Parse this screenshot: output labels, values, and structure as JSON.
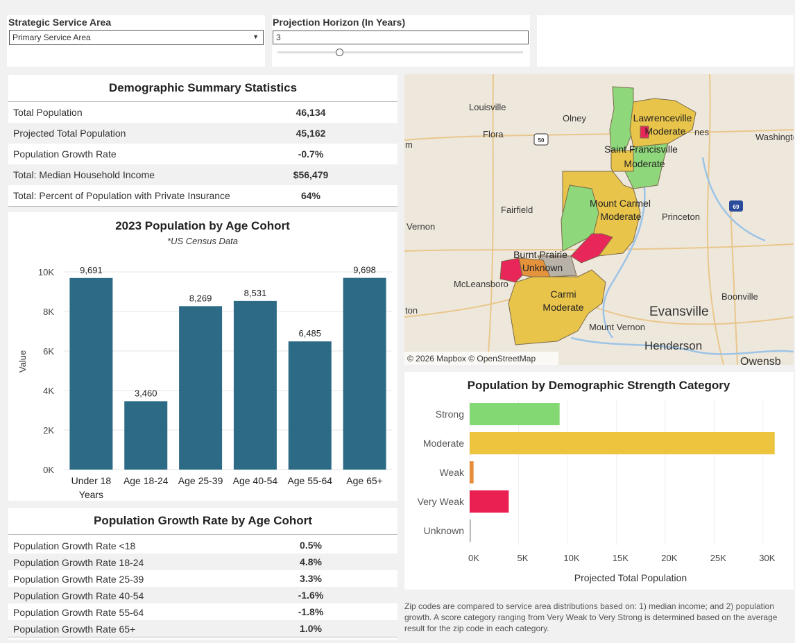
{
  "controls": {
    "service_area": {
      "title": "Strategic Service Area",
      "value": "Primary Service Area"
    },
    "horizon": {
      "title": "Projection Horizon (In Years)",
      "value": "3",
      "slider_fraction": 0.25
    }
  },
  "summary": {
    "title": "Demographic Summary Statistics",
    "rows": [
      {
        "label": "Total Population",
        "value": "46,134"
      },
      {
        "label": "Projected Total Population",
        "value": "45,162"
      },
      {
        "label": "Population Growth Rate",
        "value": "-0.7%"
      },
      {
        "label": "Total: Median Household Income",
        "value": "$56,479"
      },
      {
        "label": "Total: Percent of Population with Private Insurance",
        "value": "64%"
      }
    ]
  },
  "age_chart": {
    "chart_data": {
      "type": "bar",
      "title": "2023 Population by Age Cohort",
      "subtitle": "*US Census Data",
      "ylabel": "Value",
      "categories": [
        "Under 18\nYears",
        "Age 18-24",
        "Age 25-39",
        "Age 40-54",
        "Age 55-64",
        "Age 65+"
      ],
      "values": [
        9691,
        3460,
        8269,
        8531,
        6485,
        9698
      ],
      "value_labels": [
        "9,691",
        "3,460",
        "8,269",
        "8,531",
        "6,485",
        "9,698"
      ],
      "ylim": [
        0,
        10000
      ],
      "yticks": [
        0,
        2000,
        4000,
        6000,
        8000,
        10000
      ],
      "ytick_labels": [
        "0K",
        "2K",
        "4K",
        "6K",
        "8K",
        "10K"
      ],
      "color": "#2c6a86"
    }
  },
  "growth": {
    "title": "Population Growth Rate by Age Cohort",
    "rows": [
      {
        "label": "Population Growth Rate <18",
        "value": "0.5%"
      },
      {
        "label": "Population Growth Rate 18-24",
        "value": "4.8%"
      },
      {
        "label": "Population Growth Rate 25-39",
        "value": "3.3%"
      },
      {
        "label": "Population Growth Rate 40-54",
        "value": "-1.6%"
      },
      {
        "label": "Population Growth Rate 55-64",
        "value": "-1.8%"
      },
      {
        "label": "Population Growth Rate 65+",
        "value": "1.0%"
      }
    ]
  },
  "map": {
    "attribution": "© 2026 Mapbox  © OpenStreetMap",
    "places": [
      "Louisville",
      "Olney",
      "Flora",
      "Washington",
      "Fairfield",
      "Princeton",
      "Vernon",
      "McLeansboro",
      "Boonville",
      "Evansville",
      "Henderson",
      "Owensb",
      "ton",
      "nes",
      "Mount Vernon",
      "m"
    ],
    "region_labels": [
      {
        "name": "Lawrenceville",
        "cat": "Moderate"
      },
      {
        "name": "Saint Francisville",
        "cat": "Moderate"
      },
      {
        "name": "Mount Carmel",
        "cat": "Moderate"
      },
      {
        "name": "Burnt Prairie",
        "cat": "Unknown"
      },
      {
        "name": "Carmi",
        "cat": "Moderate"
      }
    ],
    "route_labels": [
      "50",
      "69"
    ],
    "colors": {
      "strong": "#8ed77a",
      "moderate": "#e9c44a",
      "weak": "#e5923c",
      "very_weak": "#e8265a",
      "unknown": "#b9b2a8"
    }
  },
  "strength_chart": {
    "chart_data": {
      "type": "bar",
      "orientation": "horizontal",
      "title": "Population by Demographic Strength Category",
      "xlabel": "Projected Total Population",
      "categories": [
        "Strong",
        "Moderate",
        "Weak",
        "Very Weak",
        "Unknown"
      ],
      "values": [
        9200,
        31200,
        400,
        4000,
        100
      ],
      "colors": [
        "#84d874",
        "#ecc43d",
        "#e58d37",
        "#ea2052",
        "#bbbbbb"
      ],
      "xlim": [
        0,
        32000
      ],
      "xticks": [
        0,
        5000,
        10000,
        15000,
        20000,
        25000,
        30000
      ],
      "xtick_labels": [
        "0K",
        "5K",
        "10K",
        "15K",
        "20K",
        "25K",
        "30K"
      ]
    }
  },
  "note": "Zip codes are compared to service area distributions based on: 1) median income; and 2) population growth. A score category ranging from Very Weak to Very Strong is determined based on the average result for the zip code in each category."
}
